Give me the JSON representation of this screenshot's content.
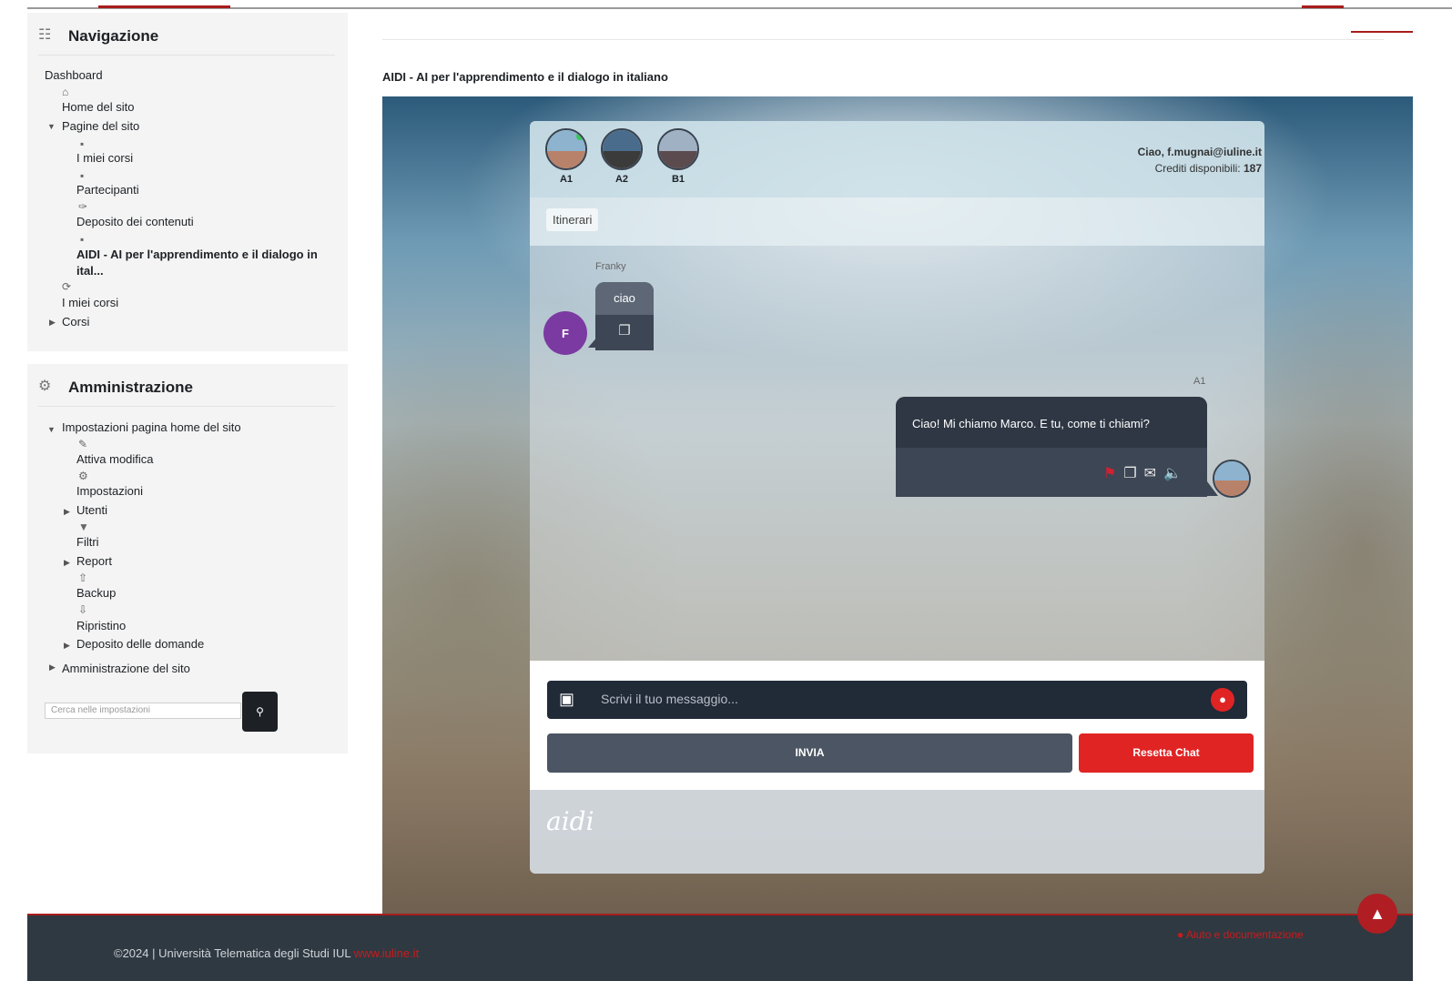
{
  "navigation": {
    "title": "Navigazione",
    "items": {
      "dashboard": "Dashboard",
      "home": "Home del sito",
      "pagine": "Pagine del sito",
      "miei_corsi_sub": "I miei corsi",
      "partecipanti": "Partecipanti",
      "deposito_contenuti": "Deposito dei contenuti",
      "aidi": "AIDI - AI per l'apprendimento e il dialogo in ital...",
      "miei_corsi": "I miei corsi",
      "corsi": "Corsi"
    }
  },
  "administration": {
    "title": "Amministrazione",
    "items": {
      "impostazioni_home": "Impostazioni pagina home del sito",
      "attiva_modifica": "Attiva modifica",
      "impostazioni": "Impostazioni",
      "utenti": "Utenti",
      "filtri": "Filtri",
      "report": "Report",
      "backup": "Backup",
      "ripristino": "Ripristino",
      "deposito_domande": "Deposito delle domande",
      "amministrazione_sito": "Amministrazione del sito"
    },
    "search_placeholder": "Cerca nelle impostazioni"
  },
  "page": {
    "title": "AIDI - AI per l'apprendimento e il dialogo in italiano"
  },
  "chat": {
    "levels": [
      "A1",
      "A2",
      "B1"
    ],
    "greeting": "Ciao, f.mugnai@iuline.it",
    "credits_label": "Crediti disponibili:",
    "credits_value": "187",
    "tab": "Itinerari",
    "user_name": "Franky",
    "user_initial": "F",
    "user_message": "ciao",
    "bot_name": "A1",
    "bot_message": "Ciao! Mi chiamo Marco. E tu, come ti chiami?",
    "input_placeholder": "Scrivi il tuo messaggio...",
    "send_label": "INVIA",
    "reset_label": "Resetta Chat",
    "logo_text": "aidi"
  },
  "footer": {
    "copyright": "©2024 | Università Telematica degli Studi IUL",
    "link": "www.iuline.it",
    "help": "Aiuto e documentazione"
  },
  "colors": {
    "accent_red": "#e02424",
    "dark_bubble": "#3d4654",
    "brand_red": "#a81c1c"
  }
}
